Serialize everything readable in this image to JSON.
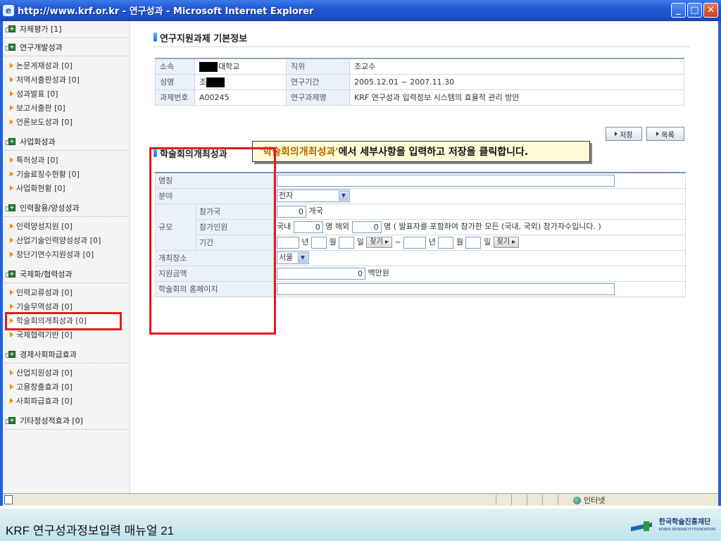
{
  "window": {
    "title": "http://www.krf.or.kr - 연구성과 - Microsoft Internet Explorer"
  },
  "sidebar": {
    "sections": [
      {
        "label": "자체평가 [1]",
        "items": []
      },
      {
        "label": "연구개발성과",
        "items": [
          "논문게재성과 [0]",
          "저역서출판성과 [0]",
          "성과발표 [0]",
          "보고서출판 [0]",
          "언론보도성과 [0]"
        ]
      },
      {
        "label": "사업화성과",
        "items": [
          "특허성과 [0]",
          "기술료징수현황 [0]",
          "사업화현황 [0]"
        ]
      },
      {
        "label": "인력활용/양성성과",
        "items": [
          "인력양성지원 [0]",
          "산업기술인력양성성과 [0]",
          "장단기연수지원성과 [0]"
        ]
      },
      {
        "label": "국제화/협력성과",
        "items": [
          "인력교류성과 [0]",
          "기술무역성과 [0]",
          "학술회의개최성과 [0]",
          "국제협력기반 [0]"
        ]
      },
      {
        "label": "경제사회파급효과",
        "items": [
          "산업지원성과 [0]",
          "고용창출효과 [0]",
          "사회파급효과 [0]"
        ]
      },
      {
        "label": "기타정성적효과 [0]",
        "items": []
      }
    ],
    "active_item": "학술회의개최성과 [0]"
  },
  "basic_info": {
    "heading": "연구지원과제 기본정보",
    "rows": [
      {
        "label1": "소속",
        "value1": "대학교",
        "label2": "직위",
        "value2": "조교수"
      },
      {
        "label1": "성명",
        "value1": "조",
        "label2": "연구기간",
        "value2": "2005.12.01 ~ 2007.11.30"
      },
      {
        "label1": "과제번호",
        "value1": "A00245",
        "label2": "연구과제명",
        "value2": "KRF 연구성과 입력정보 시스템의 효율적 관리 방안"
      }
    ]
  },
  "buttons": {
    "save": "저장",
    "list": "목록",
    "find": "찾기"
  },
  "form": {
    "heading": "학술회의개최성과",
    "callout_highlight": "'학술회의개최성과'",
    "callout_rest": " 에서 세부사항을 입력하고 저장을 클릭합니다.",
    "labels": {
      "name": "명칭",
      "field": "분야",
      "scale": "규모",
      "countries": "참가국",
      "participants": "참가인원",
      "period": "기간",
      "venue": "개최장소",
      "support": "지원금액",
      "homepage": "학술회의 홈페이지"
    },
    "values": {
      "name": "",
      "field": "전자",
      "countries": "0",
      "countries_unit": "개국",
      "domestic_label": "국내",
      "domestic": "0",
      "person_unit": "명",
      "overseas_label": "해외",
      "overseas": "0",
      "participants_note": "명 ( 발표자를 포함하여 참가한 모든 (국내, 국외) 참가자수입니다. )",
      "year_unit": "년",
      "month_unit": "월",
      "day_unit": "일",
      "tilde": "~",
      "venue": "서울",
      "support": "0",
      "support_unit": "백만원",
      "homepage": ""
    }
  },
  "statusbar": {
    "zone": "인터넷"
  },
  "footer": {
    "text": "KRF 연구성과정보입력 매뉴얼 21",
    "logo_main": "한국학술진흥재단",
    "logo_sub": "KOREA RESEARCH FOUNDATION"
  }
}
